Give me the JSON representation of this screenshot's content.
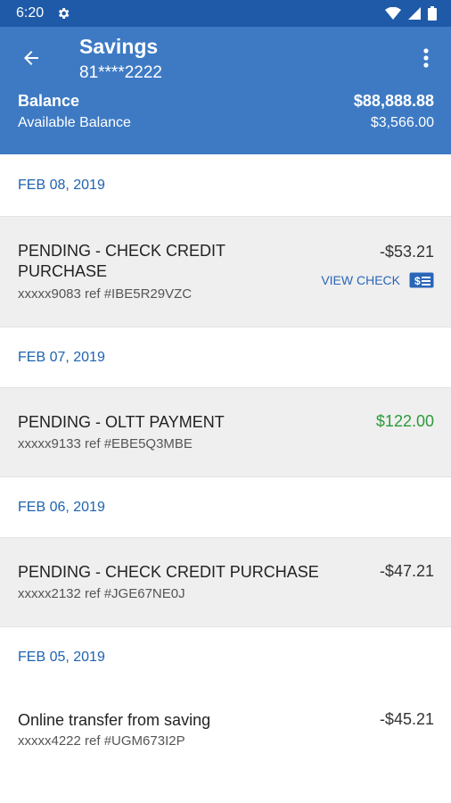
{
  "status": {
    "time": "6:20"
  },
  "header": {
    "title": "Savings",
    "account": "81****2222",
    "balance_label": "Balance",
    "balance_value": "$88,888.88",
    "available_label": "Available Balance",
    "available_value": "$3,566.00"
  },
  "groups": [
    {
      "date": "FEB 08, 2019",
      "txn": {
        "desc_line1": "PENDING - CHECK CREDIT",
        "desc_line2": "PURCHASE",
        "ref": "xxxxx9083 ref #IBE5R29VZC",
        "amount": "-$53.21",
        "action": "VIEW CHECK"
      }
    },
    {
      "date": "FEB 07, 2019",
      "txn": {
        "desc": "PENDING - OLTT PAYMENT",
        "ref": "xxxxx9133 ref #EBE5Q3MBE",
        "amount": "$122.00"
      }
    },
    {
      "date": "FEB 06, 2019",
      "txn": {
        "desc": "PENDING - CHECK CREDIT PURCHASE",
        "ref": "xxxxx2132 ref #JGE67NE0J",
        "amount": "-$47.21"
      }
    },
    {
      "date": "FEB 05, 2019",
      "txn": {
        "desc": "Online transfer from saving",
        "ref": "xxxxx4222 ref #UGM673I2P",
        "amount": "-$45.21"
      }
    }
  ],
  "colors": {
    "status_bar": "#1e5aa8",
    "header": "#3e7ac4",
    "date_text": "#1e63b0",
    "credit": "#2c9a3a"
  },
  "icons": [
    "back-arrow-icon",
    "more-vert-icon",
    "check-icon",
    "gear-icon",
    "wifi-icon",
    "signal-icon",
    "battery-icon"
  ]
}
